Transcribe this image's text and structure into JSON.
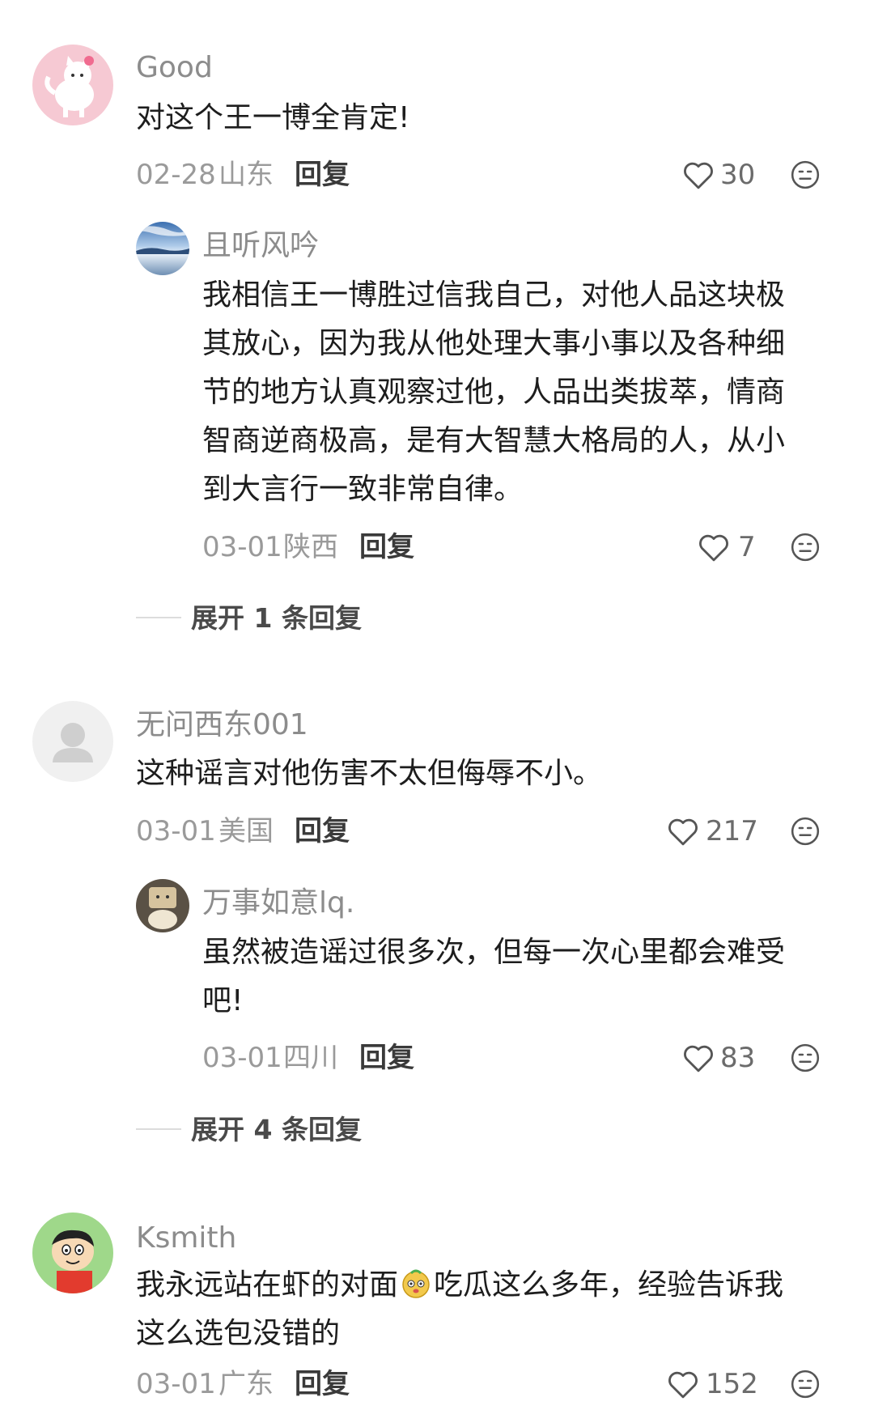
{
  "comments": [
    {
      "username": "Good",
      "text": "对这个王一博全肯定!",
      "date": "02-28",
      "location": "山东",
      "reply_label": "回复",
      "likes": "30",
      "avatar": "cat-avatar",
      "replies": [
        {
          "username": "且听风吟",
          "text_lines": [
            "我相信王一博胜过信我自己，对他人品这块极",
            "其放心，因为我从他处理大事小事以及各种细",
            "节的地方认真观察过他，人品出类拔萃，情商",
            "智商逆商极高，是有大智慧大格局的人，从小",
            "到大言行一致非常自律。"
          ],
          "date": "03-01",
          "location": "陕西",
          "reply_label": "回复",
          "likes": "7",
          "avatar": "landscape-avatar"
        }
      ],
      "expand_label": "展开 1 条回复"
    },
    {
      "username": "无问西东001",
      "text": "这种谣言对他伤害不太但侮辱不小。",
      "date": "03-01",
      "location": "美国",
      "reply_label": "回复",
      "likes": "217",
      "avatar": "default-user-avatar",
      "replies": [
        {
          "username": "万事如意lq.",
          "text_lines": [
            "虽然被造谣过很多次，但每一次心里都会难受",
            "吧!"
          ],
          "date": "03-01",
          "location": "四川",
          "reply_label": "回复",
          "likes": "83",
          "avatar": "plush-toy-avatar"
        }
      ],
      "expand_label": "展开 4 条回复"
    },
    {
      "username": "Ksmith",
      "text_lines": [
        "我永远站在虾的对面",
        "吃瓜这么多年，经验告诉我",
        "这么选包没错的"
      ],
      "date": "03-01",
      "location": "广东",
      "reply_label": "回复",
      "likes": "152",
      "avatar": "cartoon-boy-avatar"
    }
  ],
  "colors": {
    "username": "#8c8c8c",
    "text": "#1d1d1d",
    "meta": "#9a9a9a",
    "icon": "#555555"
  }
}
